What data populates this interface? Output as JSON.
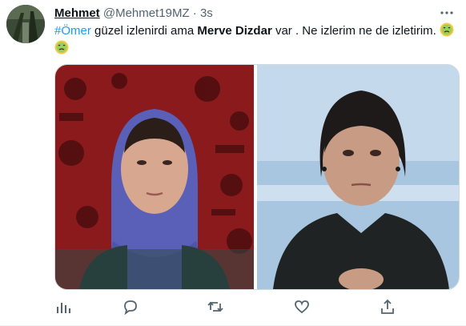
{
  "tweet": {
    "author_name": "Mehmet",
    "author_handle": "@Mehmet19MZ",
    "separator": "·",
    "time": "3s",
    "text": {
      "hashtag": "#Ömer",
      "part1": " güzel izlenirdi ama ",
      "bold": "Merve Dizdar",
      "part2": " var . Ne izlerim ne de izletirim. "
    },
    "emoji": "nauseated-face"
  },
  "actions": [
    "analytics-icon",
    "reply-icon",
    "retweet-icon",
    "like-icon",
    "share-icon"
  ],
  "colors": {
    "link": "#1d9bf0",
    "secondary": "#536471",
    "text": "#0f1419",
    "border": "#cfd9de"
  }
}
